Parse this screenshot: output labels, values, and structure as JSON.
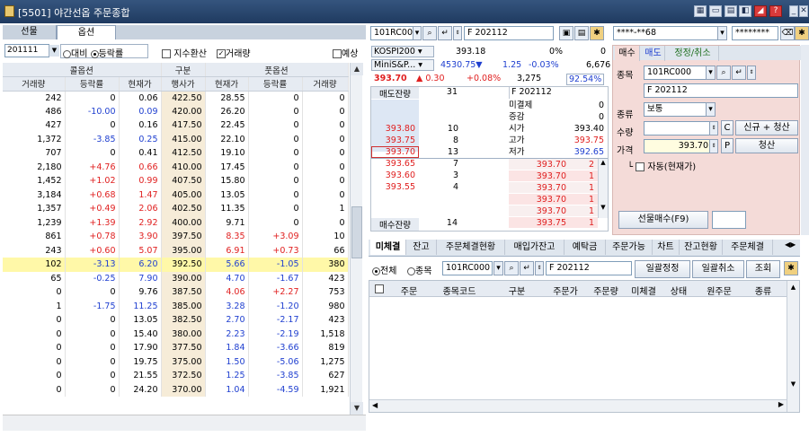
{
  "window": {
    "title": "[5501] 야간선옵 주문종합",
    "icons": [
      "window-icon",
      "layout-icon",
      "monitor-icon",
      "print-icon",
      "chart-icon",
      "alert-icon",
      "help-icon",
      "minimize-icon",
      "maximize-icon",
      "close-icon"
    ],
    "help_label": "?"
  },
  "left": {
    "tabs": [
      "선물",
      "옵션"
    ],
    "month": "201111",
    "radio_prev": "대비",
    "radio_rate": "등락률",
    "chk_index": "지수환산",
    "chk_volume": "거래량",
    "chk_expect": "예상",
    "group_call": "콜옵션",
    "group_kind": "구분",
    "group_put": "풋옵션",
    "columns": [
      "거래량",
      "등락률",
      "현재가",
      "행사가",
      "현재가",
      "등락률",
      "거래량"
    ],
    "rows": [
      [
        "242",
        "0",
        "0.06",
        "422.50",
        "28.55",
        "0",
        "0"
      ],
      [
        "486",
        "-10.00",
        "0.09",
        "420.00",
        "26.20",
        "0",
        "0"
      ],
      [
        "427",
        "0",
        "0.16",
        "417.50",
        "22.45",
        "0",
        "0"
      ],
      [
        "1,372",
        "-3.85",
        "0.25",
        "415.00",
        "22.10",
        "0",
        "0"
      ],
      [
        "707",
        "0",
        "0.41",
        "412.50",
        "19.10",
        "0",
        "0"
      ],
      [
        "2,180",
        "+4.76",
        "0.66",
        "410.00",
        "17.45",
        "0",
        "0"
      ],
      [
        "1,452",
        "+1.02",
        "0.99",
        "407.50",
        "15.80",
        "0",
        "0"
      ],
      [
        "3,184",
        "+0.68",
        "1.47",
        "405.00",
        "13.05",
        "0",
        "0"
      ],
      [
        "1,357",
        "+0.49",
        "2.06",
        "402.50",
        "11.35",
        "0",
        "1"
      ],
      [
        "1,239",
        "+1.39",
        "2.92",
        "400.00",
        "9.71",
        "0",
        "0"
      ],
      [
        "861",
        "+0.78",
        "3.90",
        "397.50",
        "8.35",
        "+3.09",
        "10"
      ],
      [
        "243",
        "+0.60",
        "5.07",
        "395.00",
        "6.91",
        "+0.73",
        "66"
      ],
      [
        "102",
        "-3.13",
        "6.20",
        "392.50",
        "5.66",
        "-1.05",
        "380"
      ],
      [
        "65",
        "-0.25",
        "7.90",
        "390.00",
        "4.70",
        "-1.67",
        "423"
      ],
      [
        "0",
        "0",
        "9.76",
        "387.50",
        "4.06",
        "+2.27",
        "753"
      ],
      [
        "1",
        "-1.75",
        "11.25",
        "385.00",
        "3.28",
        "-1.20",
        "980"
      ],
      [
        "0",
        "0",
        "13.05",
        "382.50",
        "2.70",
        "-2.17",
        "423"
      ],
      [
        "0",
        "0",
        "15.40",
        "380.00",
        "2.23",
        "-2.19",
        "1,518"
      ],
      [
        "0",
        "0",
        "17.90",
        "377.50",
        "1.84",
        "-3.66",
        "819"
      ],
      [
        "0",
        "0",
        "19.75",
        "375.00",
        "1.50",
        "-5.06",
        "1,275"
      ],
      [
        "0",
        "0",
        "21.55",
        "372.50",
        "1.25",
        "-3.85",
        "627"
      ],
      [
        "0",
        "0",
        "24.20",
        "370.00",
        "1.04",
        "-4.59",
        "1,921"
      ]
    ],
    "highlight_row": 12
  },
  "middle": {
    "code": "101RC000",
    "name": "F 202112",
    "kospi_label": "KOSPI200",
    "kospi_value": "393.18",
    "kospi_pct": "0%",
    "kospi_num": "0",
    "mini_label": "MiniS&P...",
    "mini_value": "4530.75",
    "mini_arrow": "▼",
    "mini_chg": "1.25",
    "mini_pct": "-0.03%",
    "mini_num": "6,676",
    "price": "393.70",
    "price_arrow": "▲",
    "price_chg": "0.30",
    "price_pct": "+0.08%",
    "price_vol": "3,275",
    "price_ratio": "92.54%",
    "sell_label": "매도잔량",
    "sell_total": "31",
    "buy_label": "매수잔량",
    "buy_total": "14",
    "info_name": "F 202112",
    "info": [
      [
        "미결제",
        "0"
      ],
      [
        "증감",
        "0"
      ],
      [
        "시가",
        "393.40"
      ],
      [
        "고가",
        "393.75"
      ],
      [
        "저가",
        "392.65"
      ]
    ],
    "asks": [
      [
        "393.80",
        "10"
      ],
      [
        "393.75",
        "8"
      ],
      [
        "393.70",
        "13"
      ]
    ],
    "bids": [
      [
        "393.65",
        "7"
      ],
      [
        "393.60",
        "3"
      ],
      [
        "393.55",
        "4"
      ]
    ],
    "ticks": [
      [
        "393.70",
        "2"
      ],
      [
        "393.70",
        "1"
      ],
      [
        "393.70",
        "1"
      ],
      [
        "393.70",
        "1"
      ],
      [
        "393.70",
        "1"
      ],
      [
        "393.75",
        "1"
      ]
    ]
  },
  "right": {
    "account": "****-**68",
    "password": "********",
    "tabs": [
      "매수",
      "매도",
      "정정/취소"
    ],
    "code_label": "종목",
    "code": "101RC000",
    "name": "F 202112",
    "type_label": "종류",
    "type": "보통",
    "qty_label": "수량",
    "qty": "",
    "c_label": "C",
    "new_clear": "신규 + 청산",
    "price_label": "가격",
    "price": "393.70",
    "p_label": "P",
    "clear": "청산",
    "auto_label": "자동(현재가)",
    "buy_btn": "선물매수(F9)"
  },
  "orders": {
    "tabs": [
      "미체결",
      "잔고",
      "주문체결현황",
      "매입가잔고",
      "예탁금",
      "주문가능",
      "차트",
      "잔고현황",
      "주문체결"
    ],
    "radio_all": "전체",
    "radio_item": "종목",
    "code": "101RC000",
    "name": "F 202112",
    "btn_bulk_fix": "일괄정정",
    "btn_bulk_cancel": "일괄취소",
    "btn_query": "조회",
    "columns": [
      "주문",
      "종목코드",
      "구분",
      "주문가",
      "주문량",
      "미체결",
      "상태",
      "원주문",
      "종류"
    ]
  }
}
